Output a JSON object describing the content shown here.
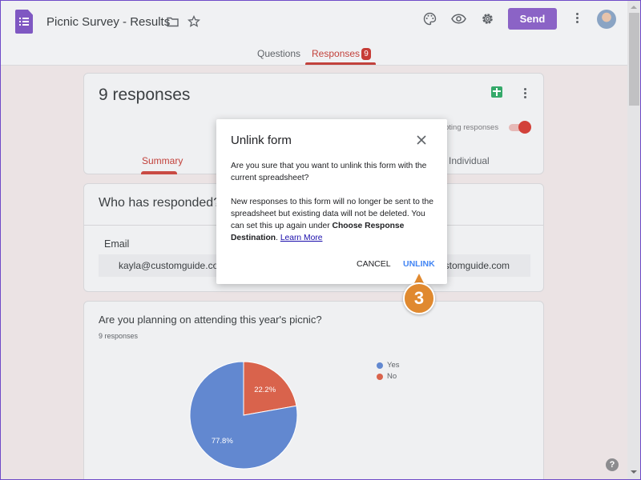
{
  "header": {
    "title": "Picnic Survey - Results",
    "send_label": "Send",
    "icons": [
      "forms-logo-icon",
      "folder-icon",
      "star-icon",
      "palette-icon",
      "preview-eye-icon",
      "settings-gear-icon",
      "more-vert-icon",
      "avatar"
    ],
    "tabs": [
      {
        "label": "Questions",
        "active": false
      },
      {
        "label": "Responses",
        "active": true,
        "badge": "9"
      }
    ],
    "accent_color": "#8b63c6"
  },
  "summary_card": {
    "title": "9 responses",
    "accepting_label": "Accepting responses",
    "accepting_visible": "pting responses",
    "accepting_on": true,
    "subtabs": [
      {
        "label": "Summary",
        "active": true
      },
      {
        "label": "Individual",
        "active": false
      }
    ]
  },
  "who_card": {
    "title": "Who has responded?",
    "email_label": "Email",
    "email_value_left": "kayla@customguide.com,",
    "email_value_right": "ustomguide.com"
  },
  "question_card": {
    "title": "Are you planning on attending this year's picnic?",
    "count": "9 responses"
  },
  "dialog": {
    "title": "Unlink form",
    "para1": "Are you sure that you want to unlink this form with the current spreadsheet?",
    "para2_start": "New responses to this form will no longer be sent to the spreadsheet but existing data will not be deleted. You can set this up again under ",
    "para2_bold": "Choose Response Destination",
    "para2_end": ". ",
    "learn_more": "Learn More",
    "cancel_label": "CANCEL",
    "unlink_label": "UNLINK"
  },
  "callout": {
    "step": "3"
  },
  "chart_data": {
    "type": "pie",
    "title": "Are you planning on attending this year's picnic?",
    "categories": [
      "Yes",
      "No"
    ],
    "values": [
      77.8,
      22.2
    ],
    "labels": [
      "77.8%",
      "22.2%"
    ],
    "colors": [
      "#6288d0",
      "#d9634c"
    ],
    "legend": "right"
  }
}
